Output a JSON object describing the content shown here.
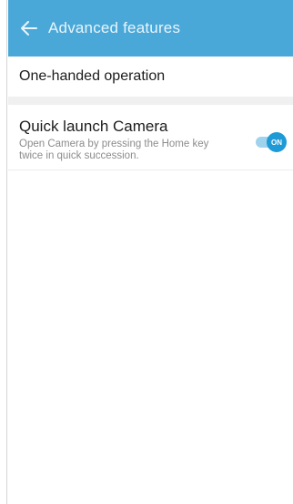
{
  "header": {
    "title": "Advanced features",
    "back_icon": "arrow-left-icon"
  },
  "settings": {
    "one_handed": {
      "label": "One-handed operation"
    },
    "quick_launch": {
      "title": "Quick launch Camera",
      "description": "Open Camera by pressing the Home key twice in quick succession.",
      "toggle_state": "ON",
      "enabled": true
    }
  },
  "colors": {
    "header_bg": "#4aa8d8",
    "accent": "#1e9ad6",
    "toggle_track": "#9fd2ec"
  }
}
